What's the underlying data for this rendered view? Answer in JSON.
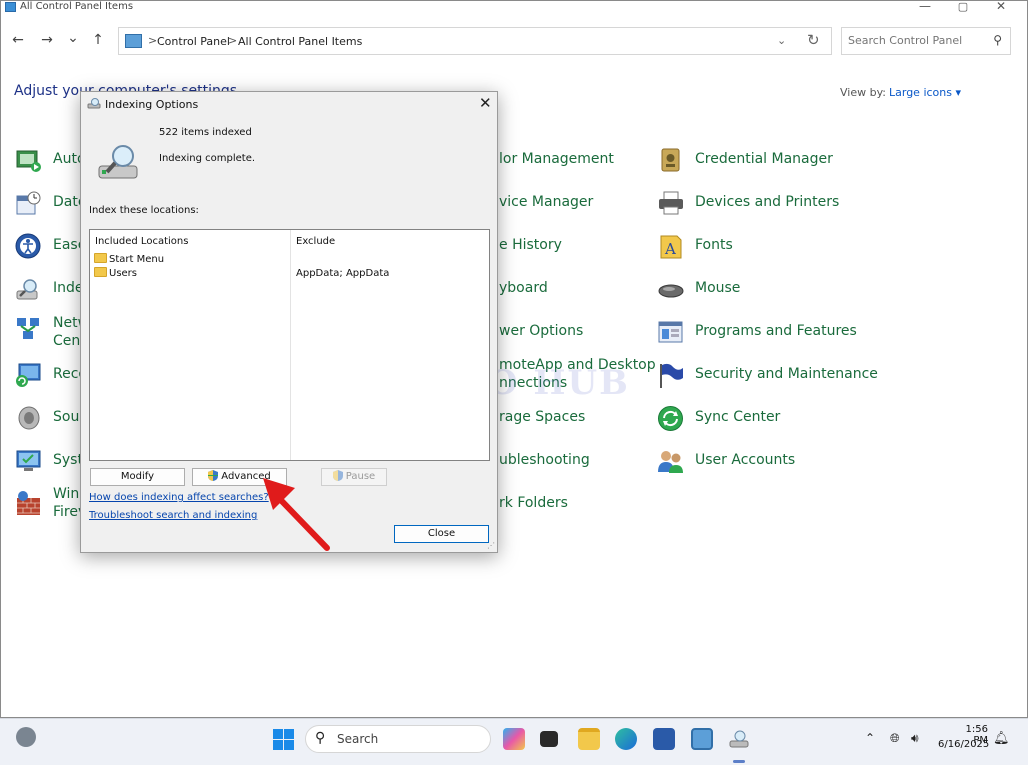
{
  "window": {
    "title": "All Control Panel Items",
    "controls": {
      "minimize": "—",
      "maximize": "▢",
      "close": "✕"
    }
  },
  "nav": {
    "back": "←",
    "forward": "→",
    "recent": "⌄",
    "up": "↑"
  },
  "address": {
    "parts": [
      "Control Panel",
      "All Control Panel Items"
    ],
    "separator": ">",
    "dropdown": "⌄",
    "refresh": "↻"
  },
  "search": {
    "placeholder": "Search Control Panel",
    "icon": "search-icon"
  },
  "heading": "Adjust your computer's settings",
  "view_by": {
    "label": "View by:",
    "value": "Large icons",
    "caret": "▾"
  },
  "left_items": [
    {
      "label": "Auto",
      "icon": "autoplay-icon"
    },
    {
      "label": "Date",
      "icon": "date-time-icon"
    },
    {
      "label": "Ease",
      "icon": "ease-of-access-icon"
    },
    {
      "label": "Inde",
      "icon": "indexing-icon"
    },
    {
      "label": "Netw",
      "label2": "Cent",
      "icon": "network-icon"
    },
    {
      "label": "Reco",
      "icon": "recovery-icon"
    },
    {
      "label": "Soun",
      "icon": "sound-icon"
    },
    {
      "label": "Syste",
      "icon": "system-icon"
    },
    {
      "label": "Wind",
      "label2": "Firev",
      "icon": "firewall-icon"
    }
  ],
  "middle_items": [
    {
      "label": "lor Management"
    },
    {
      "label": "vice Manager"
    },
    {
      "label": "e History"
    },
    {
      "label": "yboard"
    },
    {
      "label": "wer Options"
    },
    {
      "label": "moteApp and Desktop",
      "label2": "nnections"
    },
    {
      "label": "rage Spaces"
    },
    {
      "label": "ubleshooting"
    },
    {
      "label": "rk Folders"
    }
  ],
  "right_items": [
    {
      "label": "Credential Manager",
      "icon": "credential-icon"
    },
    {
      "label": "Devices and Printers",
      "icon": "printer-icon"
    },
    {
      "label": "Fonts",
      "icon": "fonts-icon"
    },
    {
      "label": "Mouse",
      "icon": "mouse-icon"
    },
    {
      "label": "Programs and Features",
      "icon": "programs-icon"
    },
    {
      "label": "Security and Maintenance",
      "icon": "flag-icon"
    },
    {
      "label": "Sync Center",
      "icon": "sync-icon"
    },
    {
      "label": "User Accounts",
      "icon": "users-icon"
    }
  ],
  "watermark": "IT PRO HUB",
  "dialog": {
    "title": "Indexing Options",
    "close": "✕",
    "count": "522 items indexed",
    "status": "Indexing complete.",
    "locations_label": "Index these locations:",
    "columns": {
      "included": "Included Locations",
      "exclude": "Exclude"
    },
    "locations": [
      {
        "name": "Start Menu",
        "exclude": ""
      },
      {
        "name": "Users",
        "exclude": "AppData; AppData"
      }
    ],
    "buttons": {
      "modify": "Modify",
      "advanced": "Advanced",
      "pause": "Pause",
      "close": "Close"
    },
    "links": {
      "how": "How does indexing affect searches?",
      "troubleshoot": "Troubleshoot search and indexing"
    }
  },
  "taskbar": {
    "search_label": "Search",
    "time": "1:56 PM",
    "date": "6/16/2025",
    "apps": [
      "copilot-icon",
      "terminal-icon",
      "file-explorer-icon",
      "edge-icon",
      "store-icon",
      "control-panel-icon",
      "indexing-options-icon"
    ],
    "tray": [
      "chevron-up-icon",
      "globe-icon",
      "volume-icon",
      "bell-icon"
    ]
  },
  "colors": {
    "link": "#1a6b3c",
    "heading": "#1e3287",
    "accent": "#0067c0",
    "arrow": "#e01b1b"
  }
}
